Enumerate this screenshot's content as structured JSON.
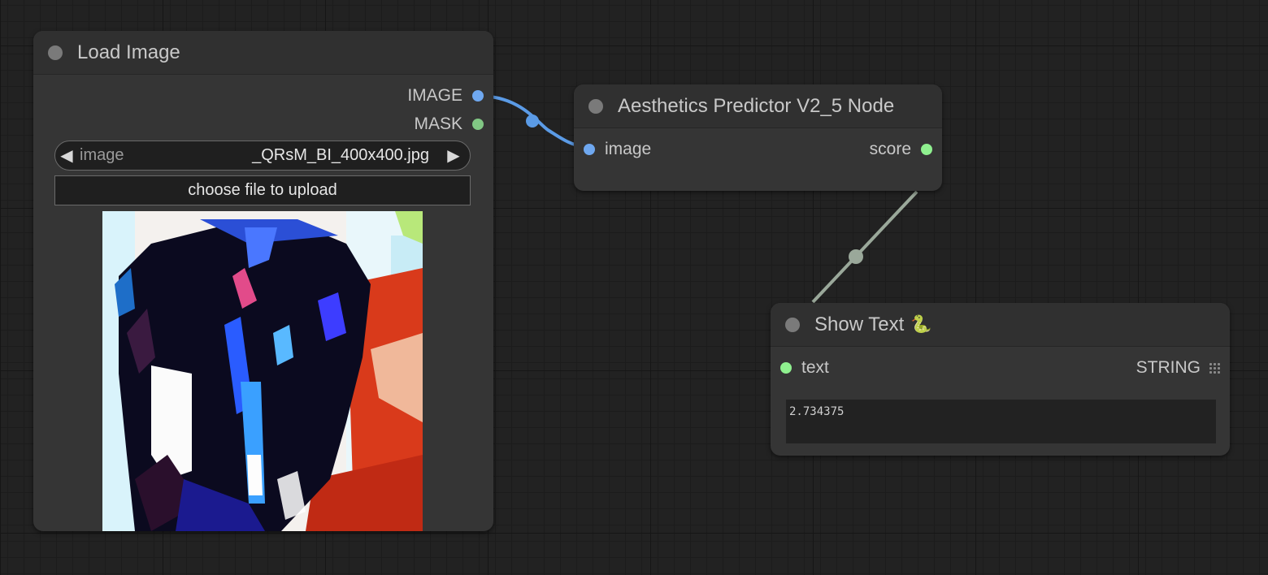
{
  "colors": {
    "image_slot": "#6fa8f0",
    "mask_slot": "#81c784",
    "score_slot": "#8ff08f",
    "string_slot": "#8ff08f",
    "image_link": "#5b9be6",
    "float_link": "#9aa89a",
    "title_dot": "#7a7a7a"
  },
  "nodes": {
    "load_image": {
      "title": "Load Image",
      "outputs": {
        "image": "IMAGE",
        "mask": "MASK"
      },
      "widget_image": {
        "label": "image",
        "value": "_QRsM_BI_400x400.jpg",
        "prev_icon": "◀",
        "next_icon": "▶"
      },
      "upload_button": "choose file to upload",
      "preview_icon": "image-preview"
    },
    "aesthetics": {
      "title": "Aesthetics Predictor V2_5 Node",
      "inputs": {
        "image": "image"
      },
      "outputs": {
        "score": "score"
      }
    },
    "show_text": {
      "title": "Show Text",
      "title_emoji": "🐍",
      "inputs": {
        "text": "text"
      },
      "outputs": {
        "string": "STRING"
      },
      "text_value": "2.734375"
    }
  }
}
